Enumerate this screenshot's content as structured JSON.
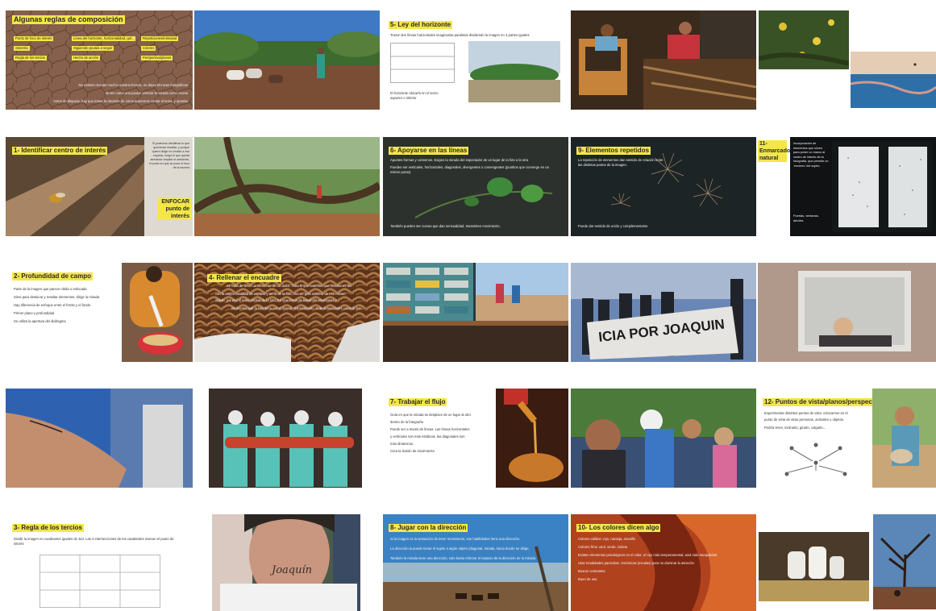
{
  "slides": {
    "s1": {
      "title": "Algunas reglas de composición",
      "labels": [
        "Punto de foco de interés",
        "Línea del horizonte, horizontalidad, gol...",
        "Repeticiones/intimidad",
        "Simetría",
        "Siguiendo pautas a seguir",
        "Colores",
        "Regla de los tercios",
        "Hecho de acción",
        "Perspectiva/planos"
      ],
      "lines": [
        "No existen recetas mucho nuestra técnica, no dejas técnicas fotográficas",
        "Sirven como una pautar orientar la mirada como receta",
        "Antes de disparar, hay que tomar la decisión de cómo queremos contar el tema, y apostar"
      ]
    },
    "s3": {
      "title": "5- Ley del horizonte",
      "intro": "Trazar dos líneas horizontales imaginarias paralelas dividiendo la imagen en 3 partes iguales",
      "note": "El horizonte ubicarlo en el tercio superior o inferior"
    },
    "s6": {
      "title": "1- Identificar centro de interés",
      "side": "Si podemos identificar lo que queremos resaltar, y porque quiero dirigir mi mirada a ese espacio, luego lo que queda alrededor ampliar el ambiente, el punto en que se pone el foco de la escena",
      "focus": "ENFOCAR punto de interés"
    },
    "s8": {
      "title": "6- Apoyarse en las líneas",
      "text": "Apuntes formas y contornos. Exigen la mirada del espectador de un lugar de la foto a la otra",
      "text2": "Pueden ser verticales, horizontales, diagonales, divergentes o convergentes (puntitos que converge en un mismo punto)",
      "bottom": "También pueden ser curvas que dan sensualidad, transmiten movimiento."
    },
    "s9": {
      "title": "9- Elementos repetidos",
      "text": "La repetición de elementos dan sentido de relación entre las distintas partes de la imagen.",
      "bottom": "Puede dar sentido de unión y complementarse"
    },
    "s10": {
      "title": "11- Enmarcado natural",
      "side": "Incorporación de elementos que sirven para poner un marco al centro de interés de la fotografía, que permite un 'encierro' del sujeto.",
      "side2": "Puertas, ventanas, árboles"
    },
    "s12": {
      "title": "2- Profundidad de campo",
      "lines": [
        "Parte de la imagen que parece nítida o enfocada",
        "Sirve para destacar y resaltar elementos, dirige la mirada",
        "Hay diferencia de enfoque entre el frente y el fondo",
        "Primer plano y profundidad",
        "Se utiliza la apertura del diafragma"
      ]
    },
    "s14": {
      "title": "4- Rellenar el encuadre",
      "lines": [
        "Se trata de tener un elemento de un único. Todo lo que tenemos que mostrar es del",
        "con la mayor cantidad de espacio y tema de la foto, con un gran número de ese mismo",
        "objeto, por eso el tema central de la foto. Es una forma de transmitir emociones y",
        "elementos que la foto llena por sí mismo, transmitiendo otras sensaciones como la tem"
      ]
    },
    "s17": {
      "banner": "ICIA POR JOAQUIN"
    },
    "s21": {
      "title": "7- Trabajar el flujo",
      "lines": [
        "Guía en que la mirada se desplace de un lugar al otro",
        "dentro de la fotografía",
        "Puede ser a través de líneas. Las líneas horizontales",
        "y verticales son más estáticas, las diagonales son",
        "más dinámicas.",
        "Crea la ilusión de movimiento"
      ]
    },
    "s24": {
      "title": "12- Puntos de vista/planos/perspectivas",
      "lines": [
        "Experimentar distintos puntos de vista: colocarnos en el",
        "punto de vista de otras personas, animales u objetos.",
        "Podría tener, inclinarlo, girarlo, colgarlo..."
      ]
    },
    "s26": {
      "title": "3- Regla de los tercios",
      "text": "Dividir la imagen en cuadrantes iguales de 3x3. Las 4 intersecciones de los cuadrantes marcan el punto de interés"
    },
    "s27": {
      "tattoo": "Joaquín"
    },
    "s28": {
      "title": "8- Jugar con la dirección",
      "lines": [
        "Si la imagen es la sensación de tener movimiento, son habilidades tiene una dirección.",
        "La dirección la puede tomar el sujeto o algún objeto (diagonal, mirada, hacia donde se dirige.",
        "También la mirada tiene una dirección, solo basta reforzar el espacio de la dirección de la mirada."
      ]
    },
    "s29": {
      "title": "10- Los colores dicen algo",
      "lines": [
        "Colores cálidos: rojo, naranja, amarillo",
        "Colores fríos: azul, verde, violeta",
        "Existen elementos psicológicos en el color, el rojo más temperamental, azul más tranquilidad",
        "Usar tonalidades parecidas. Armónicas (escalas) para no dominar la atención",
        "Buscar contrastes",
        "Buen de uso"
      ]
    }
  }
}
